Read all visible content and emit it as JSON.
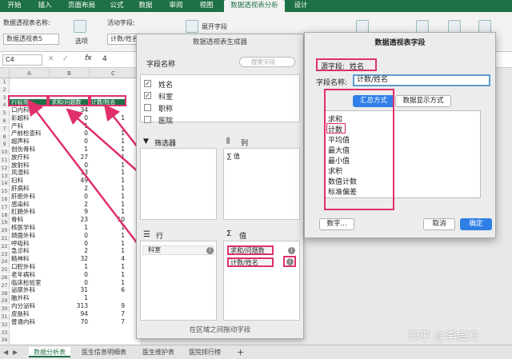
{
  "tabs": [
    "开始",
    "插入",
    "页面布局",
    "公式",
    "数据",
    "审阅",
    "视图",
    "数据透视表分析",
    "设计"
  ],
  "ribbon": {
    "pt_name_label": "数据透视表名称:",
    "pt_name_value": "数据透视表5",
    "options": "选项",
    "active_field_label": "活动字段:",
    "active_field_value": "计数/姓名",
    "expand": "展开字段"
  },
  "formula": {
    "cellref": "C4",
    "fx": "fx",
    "value": "4"
  },
  "grid": {
    "cols": [
      "A",
      "B",
      "C"
    ],
    "headers": [
      "行标签",
      "求和/问题数",
      "计数/姓名"
    ],
    "rows": [
      [
        "口内科",
        "34",
        ""
      ],
      [
        "彩超科",
        "0",
        "1"
      ],
      [
        "产科",
        "1",
        ""
      ],
      [
        "产前检查科",
        "0",
        "1"
      ],
      [
        "超声科",
        "0",
        "1"
      ],
      [
        "创伤骨科",
        "1",
        "1"
      ],
      [
        "放疗科",
        "27",
        "1"
      ],
      [
        "放射科",
        "0",
        "1"
      ],
      [
        "风湿科",
        "13",
        "1"
      ],
      [
        "妇科",
        "49",
        "1"
      ],
      [
        "肝病科",
        "2",
        "1"
      ],
      [
        "肝胆外科",
        "0",
        "1"
      ],
      [
        "感染科",
        "2",
        "1"
      ],
      [
        "肛肠外科",
        "9",
        "1"
      ],
      [
        "骨科",
        "23",
        "10"
      ],
      [
        "核医学科",
        "1",
        "1"
      ],
      [
        "颌面外科",
        "0",
        "1"
      ],
      [
        "呼吸科",
        "0",
        "1"
      ],
      [
        "急诊科",
        "2",
        "1"
      ],
      [
        "精神科",
        "32",
        "4"
      ],
      [
        "口腔外科",
        "1",
        "1"
      ],
      [
        "老年病科",
        "0",
        "1"
      ],
      [
        "临床检验室",
        "0",
        "1"
      ],
      [
        "泌尿外科",
        "31",
        "6"
      ],
      [
        "脑外科",
        "1",
        ""
      ],
      [
        "内分泌科",
        "313",
        "9"
      ],
      [
        "皮肤科",
        "94",
        "7"
      ],
      [
        "普通内科",
        "70",
        "7"
      ]
    ]
  },
  "sheets": [
    "数据分析表",
    "医生信息明细表",
    "医生维护表",
    "医院排行榜"
  ],
  "builder": {
    "title": "数据透视表生成器",
    "field_name": "字段名称",
    "search_placeholder": "搜索字段",
    "fields": [
      {
        "name": "姓名",
        "checked": "✓"
      },
      {
        "name": "科室",
        "checked": "✓"
      },
      {
        "name": "职称",
        "checked": ""
      },
      {
        "name": "医院",
        "checked": ""
      }
    ],
    "filter": "筛选器",
    "columns": "列",
    "col_value": "∑ 值",
    "rows": "行",
    "row_item": "科室",
    "values": "值",
    "val1": "求和/问题数",
    "val2": "计数/姓名",
    "footer": "在区域之间拖动字段"
  },
  "dialog": {
    "title": "数据透视表字段",
    "source_label": "源字段:",
    "source_value": "姓名",
    "name_label": "字段名称:",
    "name_value": "计数/姓名",
    "tab1": "汇总方式",
    "tab2": "数据显示方式",
    "items": [
      "求和",
      "计数",
      "平均值",
      "最大值",
      "最小值",
      "求积",
      "数值计数",
      "标准偏差"
    ],
    "selected_index": 1,
    "number_btn": "数字...",
    "cancel": "取消",
    "ok": "确定"
  },
  "watermark": "知乎 @李启方",
  "colors": {
    "excel_green": "#1e7145",
    "highlight": "#e0306a",
    "ok_blue": "#2f7fe6"
  }
}
